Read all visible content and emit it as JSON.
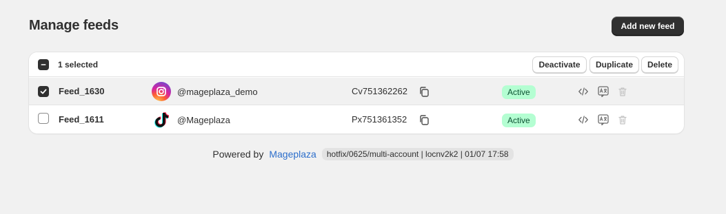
{
  "header": {
    "title": "Manage feeds",
    "add_button_label": "Add new feed"
  },
  "bulk_bar": {
    "selected_label": "1 selected",
    "actions": [
      "Deactivate",
      "Duplicate",
      "Delete"
    ]
  },
  "feeds": [
    {
      "name": "Feed_1630",
      "checked": true,
      "platform_icon": "instagram-icon",
      "account": "@mageplaza_demo",
      "feed_id": "Cv751362262",
      "status": "Active"
    },
    {
      "name": "Feed_1611",
      "checked": false,
      "platform_icon": "tiktok-icon",
      "account": "@Mageplaza",
      "feed_id": "Px751361352",
      "status": "Active"
    }
  ],
  "footer": {
    "powered_by": "Powered by",
    "brand_link": "Mageplaza",
    "version": "hotfix/0625/multi-account | locnv2k2 | 01/07 17:58"
  },
  "colors": {
    "primary_button": "#303030",
    "status_active_bg": "#b4fed2",
    "status_active_text": "#0c5132",
    "link": "#2c6ecb"
  }
}
